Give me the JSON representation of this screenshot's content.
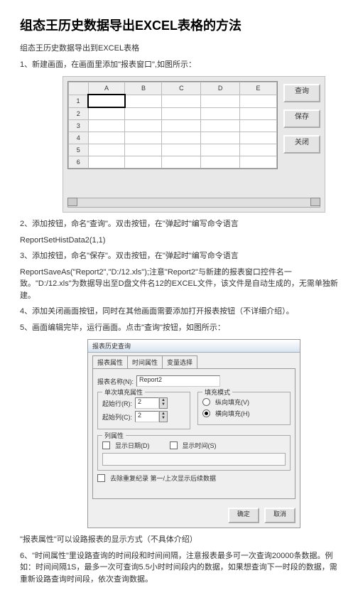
{
  "title": "组态王历史数据导出EXCEL表格的方法",
  "p1": "组态王历史数据导出到EXCEL表格",
  "p2": "1、新建画面，在画面里添加\"报表窗口\",如图所示：",
  "sheet": {
    "cols": [
      "",
      "A",
      "B",
      "C",
      "D",
      "E"
    ],
    "rows": [
      "1",
      "2",
      "3",
      "4",
      "5",
      "6"
    ]
  },
  "btns1": {
    "query": "查询",
    "save": "保存",
    "close": "关闭"
  },
  "p3": "2、添加按钮，命名\"查询\"。双击按钮，在\"弹起时\"编写命令语言",
  "code1": "ReportSetHistData2(1,1)",
  "p4": "3、添加按钮，命名\"保存\"。双击按钮，在\"弹起时\"编写命令语言",
  "code2": "ReportSaveAs(\"Report2\",\"D:/12.xls\");注意\"Report2\"与新建的报表窗口控件名一致。\"D:/12.xls\"为数据导出至D盘文件名12的EXCEL文件，该文件是自动生成的，无需单独新建。",
  "p5": "4、添加关闭画面按钮，同时在其他画面需要添加打开报表按钮（不详细介绍）。",
  "p6": "5、画面编辑完毕，运行画面。点击\"查询\"按钮，如图所示：",
  "dialog": {
    "title": "报表历史查询",
    "tabs": [
      "报表属性",
      "时间属性",
      "变量选择"
    ],
    "reportLabel": "报表名称(N):",
    "reportValue": "Report2",
    "grp1": "单次填充属性",
    "startRow": "起始行(R):",
    "startRowVal": "2",
    "startCol": "起始列(C):",
    "startColVal": "2",
    "grp2": "填充模式",
    "opt1": "纵向填充(V)",
    "opt2": "横向填充(H)",
    "grp3": "列属性",
    "showDate": "显示日期(D)",
    "showTime": "显示时间(S)",
    "chk1": "去除重复纪录 第一/上次显示后续数据",
    "ok": "确定",
    "cancel": "取消"
  },
  "p7": "\"报表属性\"可以设路报表的显示方式（不具体介绍）",
  "p8": "6、\"时间属性\"里设路查询的时间段和时间间隔，注意报表最多可一次查询20000条数据。例如：时间间隔1S，最多一次可查询5.5小时时间段内的数据，如果想查询下一时段的数据，需重新设路查询时间段，依次查询数据。"
}
